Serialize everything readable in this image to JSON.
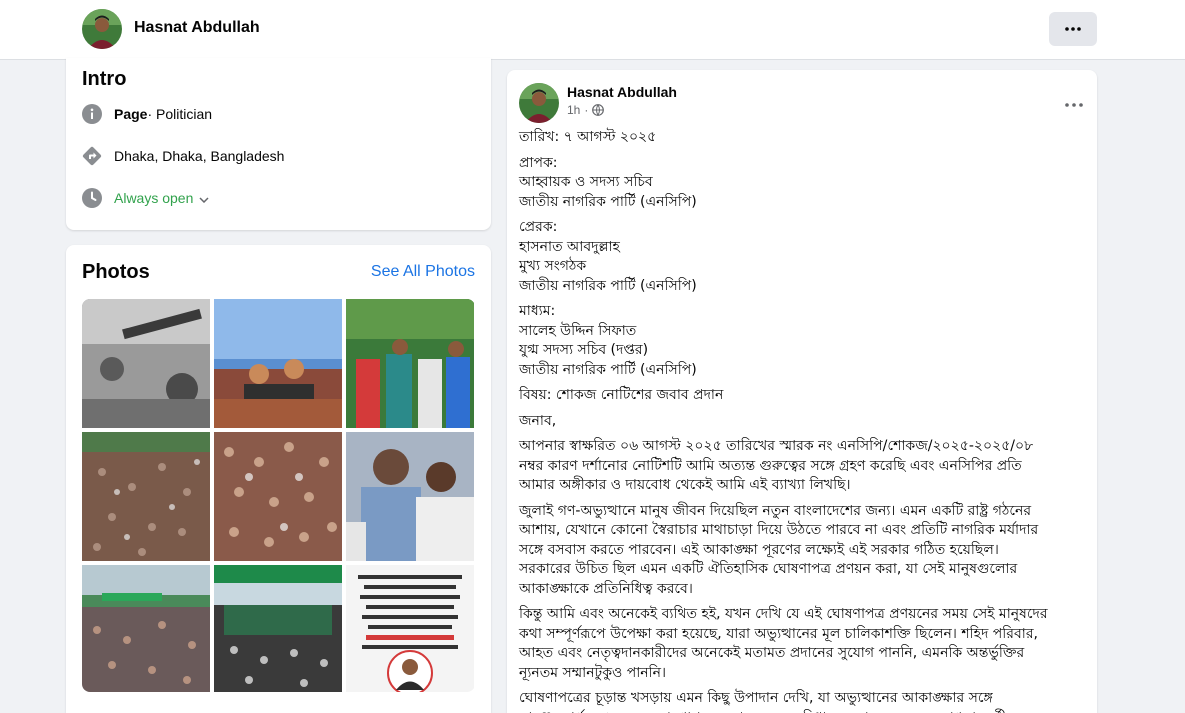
{
  "header": {
    "name": "Hasnat Abdullah",
    "more_icon": "more-horizontal-icon"
  },
  "intro": {
    "title": "Intro",
    "category_bold": "Page",
    "category_rest": " · Politician",
    "location": "Dhaka, Dhaka, Bangladesh",
    "hours": "Always open",
    "icons": [
      "info-icon",
      "location-arrow-icon",
      "clock-icon",
      "chevron-down-icon"
    ],
    "open_color": "#31a24c"
  },
  "photos": {
    "title": "Photos",
    "see_all": "See All Photos",
    "tile_count": 9,
    "link_color": "#1b74e4"
  },
  "post": {
    "author": "Hasnat Abdullah",
    "time": "1h",
    "privacy_icon": "globe-icon",
    "paragraphs": [
      "তারিখ: ৭ আগস্ট ২০২৫",
      "প্রাপক:\nআহ্বায়ক ও সদস্য সচিব\nজাতীয় নাগরিক পার্টি (এনসিপি)",
      "প্রেরক:\nহাসনাত আবদুল্লাহ\nমুখ্য সংগঠক\nজাতীয় নাগরিক পার্টি (এনসিপি)",
      "মাধ্যম:\nসালেহ উদ্দিন সিফাত\nযুগ্ম সদস্য সচিব (দপ্তর)\nজাতীয় নাগরিক পার্টি (এনসিপি)",
      "বিষয়: শোকজ নোটিশের জবাব প্রদান",
      "জনাব,",
      "আপনার স্বাক্ষরিত ০৬ আগস্ট ২০২৫ তারিখের স্মারক নং এনসিপি/শোকজ/২০২৫-২০২৫/০৮\nনম্বর কারণ দর্শানোর নোটিশটি আমি অত্যন্ত গুরুত্বের সঙ্গে গ্রহণ করেছি এবং এনসিপির প্রতি\nআমার অঙ্গীকার ও দায়বোধ থেকেই আমি এই ব্যাখ্যা লিখছি।",
      "জুলাই গণ-অভ্যুত্থানে মানুষ জীবন দিয়েছিল নতুন বাংলাদেশের জন্য। এমন একটি রাষ্ট্র গঠনের\nআশায়, যেখানে কোনো স্বৈরাচার মাথাচাড়া দিয়ে উঠতে পারবে না এবং প্রতিটি নাগরিক মর্যাদার\nসঙ্গে বসবাস করতে পারবেন। এই আকাঙ্ক্ষা পূরণের লক্ষ্যেই এই সরকার গঠিত হয়েছিল।\nসরকারের উচিত ছিল এমন একটি ঐতিহাসিক ঘোষণাপত্র প্রণয়ন করা, যা সেই মানুষগুলোর\nআকাঙ্ক্ষাকে প্রতিনিধিত্ব করবে।",
      "কিন্তু আমি এবং অনেকেই ব্যথিত হই, যখন দেখি যে এই ঘোষণাপত্র প্রণয়নের সময় সেই মানুষদের\nকথা সম্পূর্ণরূপে উপেক্ষা করা হয়েছে, যারা অভ্যুত্থানের মূল চালিকাশক্তি ছিলেন। শহিদ পরিবার,\nআহত এবং নেতৃত্বদানকারীদের অনেকেই মতামত প্রদানের সুযোগ পাননি, এমনকি অন্তর্ভুক্তির\nন্যূনতম সম্মানটুকুও পাননি।",
      "ঘোষণাপত্রের চূড়ান্ত খসড়ায় এমন কিছু উপাদান দেখি, যা অভ্যুত্থানের আকাঙ্ক্ষার সঙ্গে\nসামঞ্জস্যপূর্ণ নয়। যেমন, ঘোষণাপত্রে বলা হয়েছে সংবিধান সংস্কারের জন্য জনগণ পরবর্তী"
    ]
  }
}
